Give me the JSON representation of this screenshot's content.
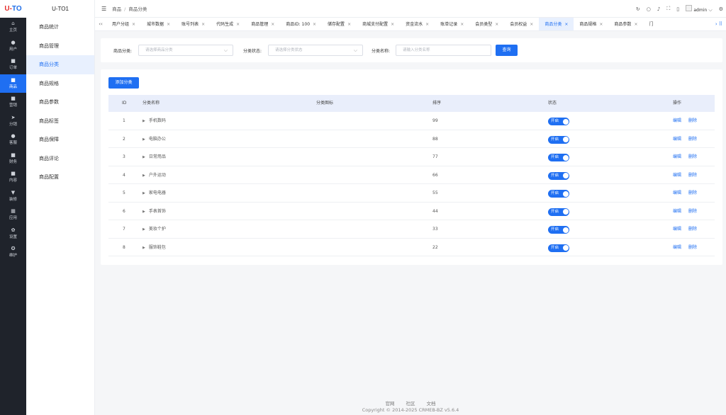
{
  "logo": {
    "u": "U-",
    "t": "TO"
  },
  "rail": [
    {
      "icon": "home-icon",
      "glyph": "⌂",
      "label": "主页"
    },
    {
      "icon": "user-icon",
      "glyph": "●",
      "label": "用户"
    },
    {
      "icon": "order-icon",
      "glyph": "■",
      "label": "订单"
    },
    {
      "icon": "product-icon",
      "glyph": "■",
      "label": "商品"
    },
    {
      "icon": "marketing-icon",
      "glyph": "■",
      "label": "营销"
    },
    {
      "icon": "share-icon",
      "glyph": "➤",
      "label": "分销"
    },
    {
      "icon": "service-icon",
      "glyph": "●",
      "label": "客服"
    },
    {
      "icon": "finance-icon",
      "glyph": "■",
      "label": "财务"
    },
    {
      "icon": "content-icon",
      "glyph": "■",
      "label": "内容"
    },
    {
      "icon": "decorate-icon",
      "glyph": "▼",
      "label": "装修"
    },
    {
      "icon": "apps-icon",
      "glyph": "▦",
      "label": "应用"
    },
    {
      "icon": "settings-icon",
      "glyph": "✿",
      "label": "设置"
    },
    {
      "icon": "maintain-icon",
      "glyph": "✪",
      "label": "维护"
    }
  ],
  "sidebar": {
    "title": "U-TO1",
    "items": [
      "商品统计",
      "商品管理",
      "商品分类",
      "商品规格",
      "商品参数",
      "商品标签",
      "商品保障",
      "商品评论",
      "商品配置"
    ]
  },
  "breadcrumb": {
    "root": "商品",
    "sep": "/",
    "current": "商品分类"
  },
  "header": {
    "user": "admin"
  },
  "tabs": [
    "用户分组",
    "城市数据",
    "账号列表",
    "代码生成",
    "商品管理",
    "商品ID: 100",
    "储存配置",
    "商城支付配置",
    "资金流水",
    "账单记录",
    "会员类型",
    "会员权益",
    "商品分类",
    "商品规格",
    "商品参数",
    "门"
  ],
  "filter": {
    "category_label": "商品分类:",
    "category_placeholder": "请选择商品分类",
    "status_label": "分类状态:",
    "status_placeholder": "请选择分类状态",
    "name_label": "分类名称:",
    "name_placeholder": "请输入分类名称",
    "query_button": "查询"
  },
  "table": {
    "add_button": "添加分类",
    "columns": {
      "id": "ID",
      "name": "分类名称",
      "icon": "分类图标",
      "sort": "排序",
      "status": "状态",
      "ops": "操作"
    },
    "rows": [
      {
        "id": "1",
        "name": "手机数码",
        "sort": "99",
        "status": "开启"
      },
      {
        "id": "2",
        "name": "电脑办公",
        "sort": "88",
        "status": "开启"
      },
      {
        "id": "3",
        "name": "日常用品",
        "sort": "77",
        "status": "开启"
      },
      {
        "id": "4",
        "name": "户外运动",
        "sort": "66",
        "status": "开启"
      },
      {
        "id": "5",
        "name": "家电电器",
        "sort": "55",
        "status": "开启"
      },
      {
        "id": "6",
        "name": "手表首饰",
        "sort": "44",
        "status": "开启"
      },
      {
        "id": "7",
        "name": "美妆个护",
        "sort": "33",
        "status": "开启"
      },
      {
        "id": "8",
        "name": "服饰鞋包",
        "sort": "22",
        "status": "开启"
      }
    ],
    "edit_label": "编辑",
    "delete_label": "删除"
  },
  "footer": {
    "links": [
      "官网",
      "社区",
      "文档"
    ],
    "copyright": "Copyright © 2014-2025 CRMEB-BZ v5.6.4"
  },
  "colors": {
    "accent": "#1f6ff2",
    "rail_bg": "#1f232b",
    "active_bg": "#e8f0fe"
  }
}
